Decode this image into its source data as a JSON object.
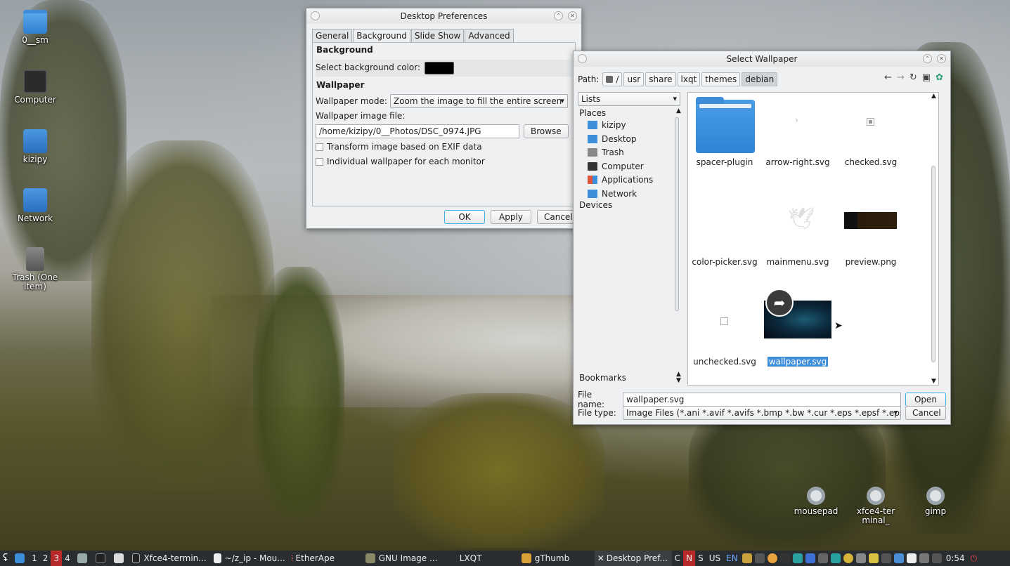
{
  "desktop": {
    "icons": [
      {
        "label": "0__sm",
        "icon": "folder-icon"
      },
      {
        "label": "Computer",
        "icon": "computer-icon"
      },
      {
        "label": "kizipy",
        "icon": "home-folder-icon"
      },
      {
        "label": "Network",
        "icon": "network-icon"
      },
      {
        "label": "Trash (One item)",
        "icon": "trash-icon"
      }
    ],
    "launchers": [
      {
        "label": "mousepad",
        "icon": "gear-icon"
      },
      {
        "label": "xfce4-terminal_",
        "icon": "gear-icon"
      },
      {
        "label": "gimp",
        "icon": "gear-icon"
      }
    ]
  },
  "prefs": {
    "title": "Desktop Preferences",
    "tabs": [
      "General",
      "Background",
      "Slide Show",
      "Advanced"
    ],
    "active_tab": "Background",
    "background_group": "Background",
    "bg_color_label": "Select background color:",
    "bg_color": "#000000",
    "wallpaper_group": "Wallpaper",
    "mode_label": "Wallpaper mode:",
    "mode_value": "Zoom the image to fill the entire screen",
    "file_label": "Wallpaper image file:",
    "file_value": "/home/kizipy/0__Photos/DSC_0974.JPG",
    "browse": "Browse",
    "exif_label": "Transform image based on EXIF data",
    "per_monitor_label": "Individual wallpaper for each monitor",
    "ok": "OK",
    "apply": "Apply",
    "cancel": "Cancel"
  },
  "picker": {
    "title": "Select Wallpaper",
    "path_label": "Path:",
    "crumbs": [
      "/",
      "usr",
      "share",
      "lxqt",
      "themes",
      "debian"
    ],
    "view_mode": "Lists",
    "places_header": "Places",
    "places": [
      {
        "label": "kizipy",
        "icon": "home-icon",
        "color": "#3d8ddb"
      },
      {
        "label": "Desktop",
        "icon": "desktop-icon",
        "color": "#3d8ddb"
      },
      {
        "label": "Trash",
        "icon": "trash-icon",
        "color": "#888888"
      },
      {
        "label": "Computer",
        "icon": "computer-icon",
        "color": "#333333"
      },
      {
        "label": "Applications",
        "icon": "applications-icon",
        "color": "#e0543c"
      },
      {
        "label": "Network",
        "icon": "network-icon",
        "color": "#3d8ddb"
      }
    ],
    "devices_header": "Devices",
    "bookmarks_header": "Bookmarks",
    "files": [
      {
        "name": "spacer-plugin",
        "kind": "folder"
      },
      {
        "name": "arrow-right.svg",
        "kind": "arrow"
      },
      {
        "name": "checked.svg",
        "kind": "checked"
      },
      {
        "name": "color-picker.svg",
        "kind": "blank"
      },
      {
        "name": "mainmenu.svg",
        "kind": "bird"
      },
      {
        "name": "preview.png",
        "kind": "preview"
      },
      {
        "name": "unchecked.svg",
        "kind": "unchecked"
      },
      {
        "name": "wallpaper.svg",
        "kind": "wallpaper",
        "selected": true
      }
    ],
    "filename_label": "File name:",
    "filename_value": "wallpaper.svg",
    "filetype_label": "File type:",
    "filetype_value": "Image Files (*.ani *.avif *.avifs *.bmp *.bw *.cur *.eps *.epsf *.epsi",
    "open": "Open",
    "cancel": "Cancel"
  },
  "taskbar": {
    "desktops": [
      "1",
      "2",
      "3",
      "4"
    ],
    "current_desktop": "3",
    "tasks": [
      {
        "label": "Xfce4-termin...",
        "icon": "terminal-icon"
      },
      {
        "label": "~/z_ip - Mou...",
        "icon": "editor-icon"
      },
      {
        "label": "EtherApe",
        "icon": "etherape-icon"
      },
      {
        "label": "GNU Image ...",
        "icon": "gimp-icon"
      },
      {
        "label": "LXQT",
        "icon": "lxqt-icon"
      },
      {
        "label": "gThumb",
        "icon": "gthumb-icon"
      },
      {
        "label": "Desktop Pref...",
        "icon": "close-icon"
      }
    ],
    "tray_text": [
      "C",
      "N",
      "S",
      "US",
      "EN"
    ],
    "clock": "0:54"
  }
}
